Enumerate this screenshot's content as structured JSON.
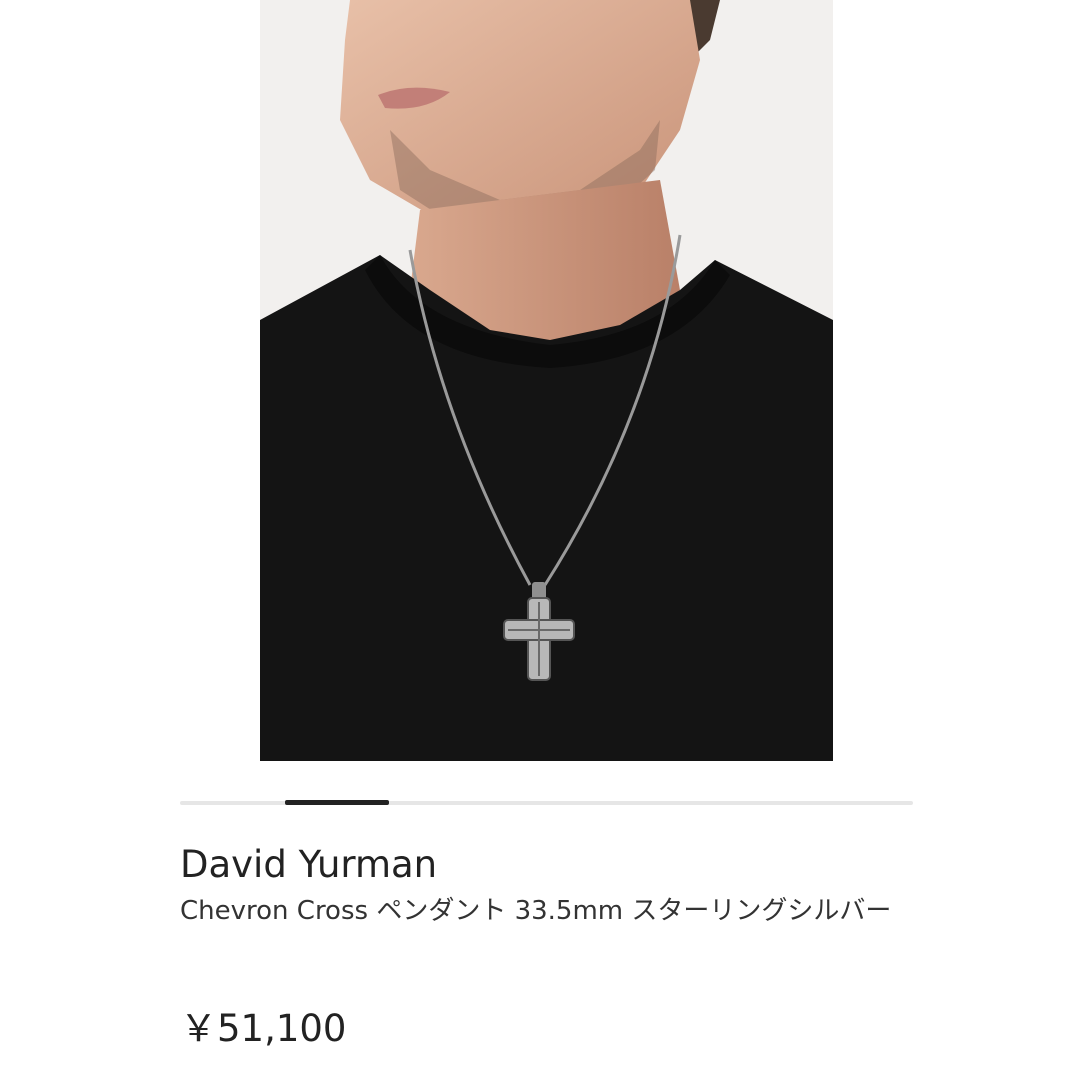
{
  "product": {
    "image_alt": "Model wearing silver cross pendant necklace with black knit sweater",
    "favorite_icon": "heart-outline-icon",
    "brand": "David Yurman",
    "name": "Chevron Cross ペンダント 33.5mm スターリングシルバー",
    "price": "￥51,100"
  },
  "carousel": {
    "total_slides": 7,
    "active_index": 1
  },
  "colors": {
    "text_primary": "#222222",
    "text_secondary": "#333333",
    "indicator_active": "#222222",
    "indicator_track": "#e6e6e6"
  }
}
